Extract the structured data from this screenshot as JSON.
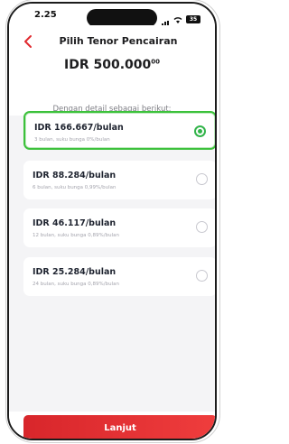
{
  "status_bar": {
    "time": "2.25",
    "battery": "35"
  },
  "header": {
    "title": "Pilih Tenor Pencairan",
    "amount": "IDR 500.000",
    "amount_superscript": "00",
    "subtitle": "Dengan detail sebagai berikut:"
  },
  "options": [
    {
      "main": "IDR 166.667/bulan",
      "sub": "3 bulan, suku bunga 0%/bulan",
      "selected": true
    },
    {
      "main": "IDR 88.284/bulan",
      "sub": "6 bulan, suku bunga 0,99%/bulan",
      "selected": false
    },
    {
      "main": "IDR 46.117/bulan",
      "sub": "12 bulan, suku bunga 0,89%/bulan",
      "selected": false
    },
    {
      "main": "IDR 25.284/bulan",
      "sub": "24 bulan, suku bunga 0,89%/bulan",
      "selected": false
    }
  ],
  "cta": {
    "label": "Lanjut"
  },
  "colors": {
    "accent": "#e0292e",
    "selected": "#3cc13b"
  },
  "icons": {
    "back": "chevron-left-icon"
  }
}
